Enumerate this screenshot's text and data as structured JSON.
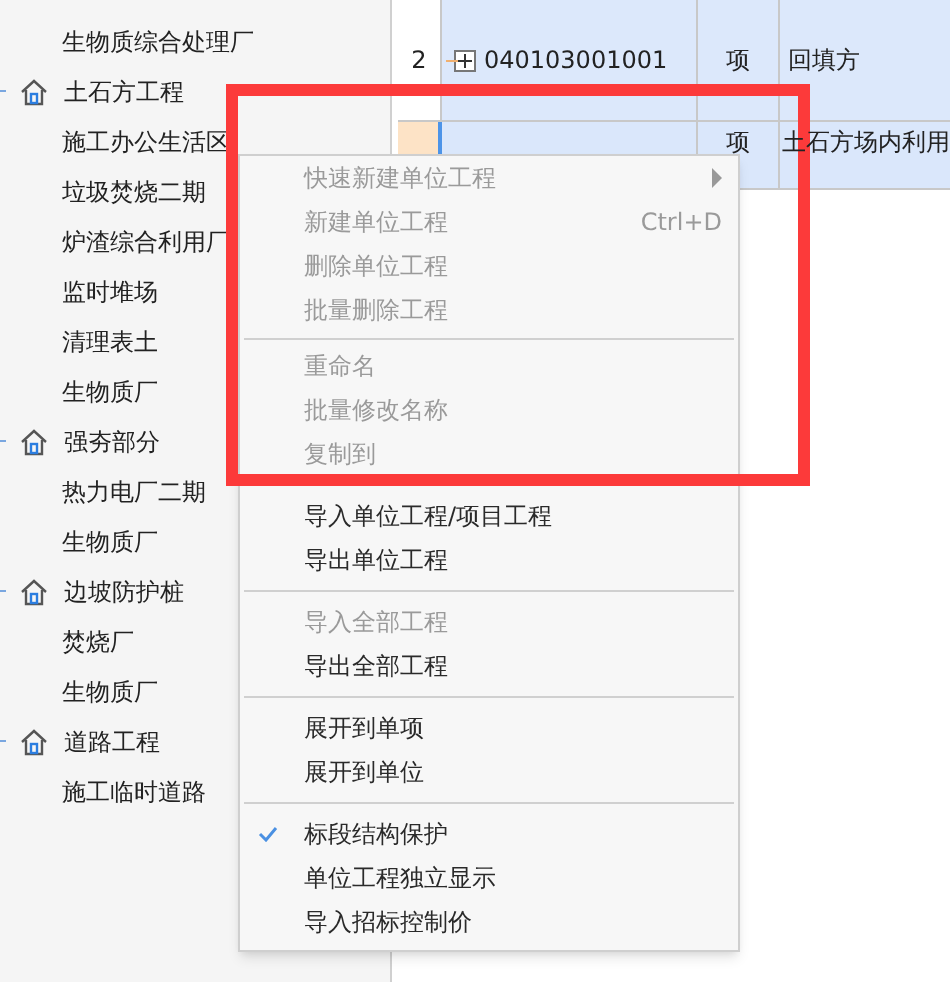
{
  "tree": [
    {
      "label": "生物质综合处理厂",
      "kind": "leaf"
    },
    {
      "label": "土石方工程",
      "kind": "group",
      "children": [
        {
          "label": "施工办公生活区",
          "kind": "leaf"
        },
        {
          "label": "垃圾焚烧二期",
          "kind": "leaf"
        },
        {
          "label": "炉渣综合利用厂",
          "kind": "leaf"
        },
        {
          "label": "监时堆场",
          "kind": "leaf"
        },
        {
          "label": "清理表土",
          "kind": "leaf"
        },
        {
          "label": "生物质厂",
          "kind": "leaf"
        }
      ]
    },
    {
      "label": "强夯部分",
      "kind": "group",
      "children": [
        {
          "label": "热力电厂二期",
          "kind": "leaf"
        },
        {
          "label": "生物质厂",
          "kind": "leaf"
        }
      ]
    },
    {
      "label": "边坡防护桩",
      "kind": "group",
      "children": [
        {
          "label": "焚烧厂",
          "kind": "leaf"
        },
        {
          "label": "生物质厂",
          "kind": "leaf"
        }
      ]
    },
    {
      "label": "道路工程",
      "kind": "group",
      "children": [
        {
          "label": "施工临时道路",
          "kind": "leaf"
        }
      ]
    }
  ],
  "table": {
    "rows": [
      {
        "number": "2",
        "code": "040103001001",
        "unit": "项",
        "name": "回填方",
        "selected": false
      },
      {
        "unit": "项",
        "name": "土石方场内利用",
        "selected": true
      }
    ]
  },
  "context_menu": {
    "sections": [
      [
        {
          "label": "快速新建单位工程",
          "disabled": true,
          "submenu": true
        },
        {
          "label": "新建单位工程",
          "disabled": true,
          "shortcut": "Ctrl+D"
        },
        {
          "label": "删除单位工程",
          "disabled": true
        },
        {
          "label": "批量删除工程",
          "disabled": true
        }
      ],
      [
        {
          "label": "重命名",
          "disabled": true
        },
        {
          "label": "批量修改名称",
          "disabled": true
        },
        {
          "label": "复制到",
          "disabled": true
        }
      ],
      [
        {
          "label": "导入单位工程/项目工程",
          "disabled": false
        },
        {
          "label": "导出单位工程",
          "disabled": false
        }
      ],
      [
        {
          "label": "导入全部工程",
          "disabled": true
        },
        {
          "label": "导出全部工程",
          "disabled": false
        }
      ],
      [
        {
          "label": "展开到单项",
          "disabled": false
        },
        {
          "label": "展开到单位",
          "disabled": false
        }
      ],
      [
        {
          "label": "标段结构保护",
          "disabled": false,
          "checked": true
        },
        {
          "label": "单位工程独立显示",
          "disabled": false,
          "checked": false
        },
        {
          "label": "导入招标控制价",
          "disabled": false,
          "checked": false
        }
      ]
    ]
  }
}
